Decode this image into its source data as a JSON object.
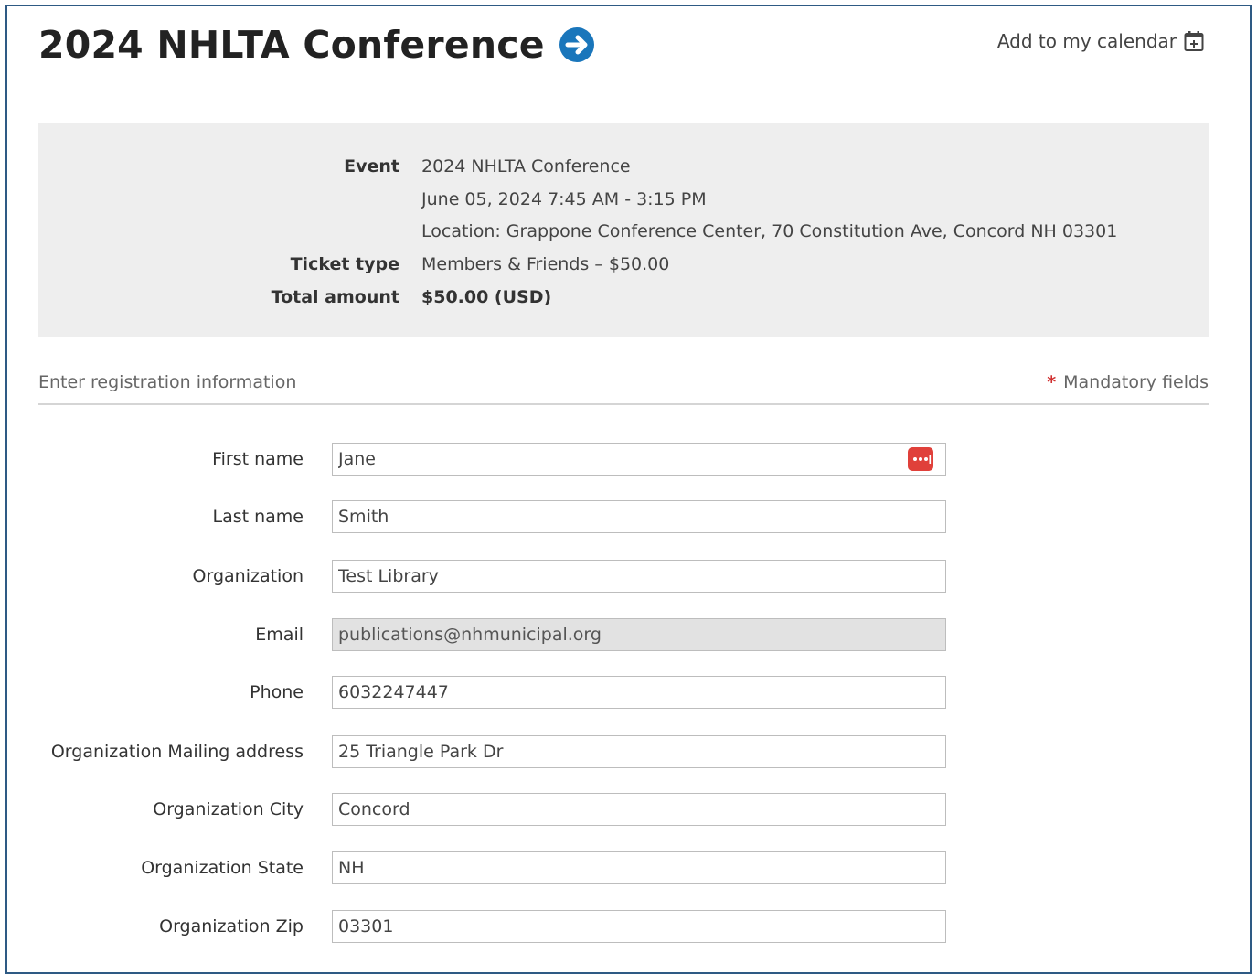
{
  "header": {
    "title": "2024 NHLTA Conference",
    "calendar_link": "Add to my calendar"
  },
  "summary": {
    "event_label": "Event",
    "event_name": "2024 NHLTA Conference",
    "event_datetime": "June 05, 2024 7:45 AM - 3:15 PM",
    "event_location": "Location: Grappone Conference Center, 70 Constitution Ave, Concord NH 03301",
    "ticket_label": "Ticket type",
    "ticket_value": "Members & Friends – $50.00",
    "total_label": "Total amount",
    "total_value": "$50.00 (USD)"
  },
  "registration": {
    "title": "Enter registration information",
    "mandatory_star": "*",
    "mandatory_text": "Mandatory fields"
  },
  "form": {
    "first_name": {
      "label": "First name",
      "value": "Jane"
    },
    "last_name": {
      "label": "Last name",
      "value": "Smith"
    },
    "organization": {
      "label": "Organization",
      "value": "Test Library"
    },
    "email": {
      "label": "Email",
      "value": "publications@nhmunicipal.org"
    },
    "phone": {
      "label": "Phone",
      "value": "6032247447"
    },
    "mailing_address": {
      "label": "Organization Mailing address",
      "value": "25 Triangle Park Dr"
    },
    "city": {
      "label": "Organization City",
      "value": "Concord"
    },
    "state": {
      "label": "Organization State",
      "value": "NH"
    },
    "zip": {
      "label": "Organization Zip",
      "value": "03301"
    }
  },
  "colors": {
    "frame_border": "#2e5a84",
    "arrow_icon": "#1a76bb",
    "summary_bg": "#eeeeee",
    "mandatory_star": "#d03030",
    "autofill_icon": "#e0403a",
    "readonly_bg": "#e2e2e2"
  },
  "icons": {
    "title_arrow": "arrow-circle-right-icon",
    "calendar": "calendar-add-icon",
    "autofill": "password-manager-icon"
  }
}
